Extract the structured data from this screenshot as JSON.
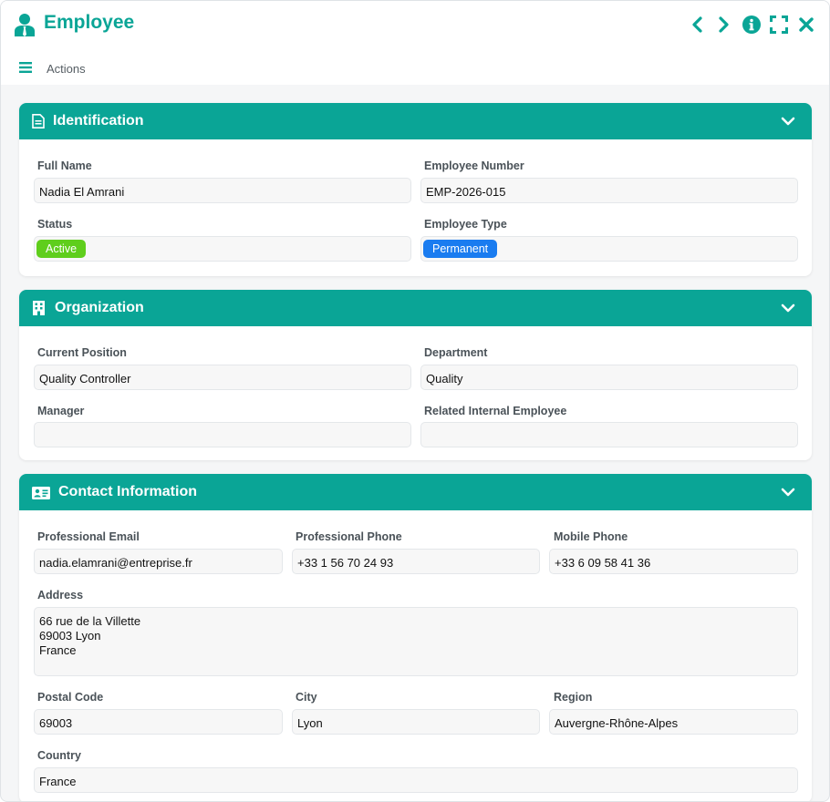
{
  "window": {
    "title": "Employee"
  },
  "actionbar": {
    "label": "Actions"
  },
  "sections": {
    "identification": {
      "title": "Identification",
      "full_name_label": "Full Name",
      "full_name": "Nadia El Amrani",
      "employee_number_label": "Employee Number",
      "employee_number": "EMP-2026-015",
      "status_label": "Status",
      "status": "Active",
      "employee_type_label": "Employee Type",
      "employee_type": "Permanent"
    },
    "organization": {
      "title": "Organization",
      "current_position_label": "Current Position",
      "current_position": "Quality Controller",
      "department_label": "Department",
      "department": "Quality",
      "manager_label": "Manager",
      "manager": "",
      "related_employee_label": "Related Internal Employee",
      "related_employee": ""
    },
    "contact": {
      "title": "Contact Information",
      "email_label": "Professional Email",
      "email": "nadia.elamrani@entreprise.fr",
      "phone_label": "Professional Phone",
      "phone": "+33 1 56 70 24 93",
      "mobile_label": "Mobile Phone",
      "mobile": "+33 6 09 58 41 36",
      "address_label": "Address",
      "address": "66 rue de la Villette\n69003 Lyon\nFrance",
      "postal_code_label": "Postal Code",
      "postal_code": "69003",
      "city_label": "City",
      "city": "Lyon",
      "region_label": "Region",
      "region": "Auvergne-Rhône-Alpes",
      "country_label": "Country",
      "country": "France"
    }
  },
  "colors": {
    "accent": "#0aa596",
    "status_active": "#5fce1c",
    "type_permanent": "#1a7cf0"
  },
  "icons": {
    "title": "user-tie-icon",
    "controls": [
      "chevron-left-icon",
      "chevron-right-icon",
      "info-icon",
      "expand-icon",
      "close-icon"
    ],
    "menu": "hamburger-icon",
    "identification": "document-icon",
    "organization": "building-icon",
    "contact": "id-card-icon",
    "collapse": "chevron-down-icon"
  }
}
